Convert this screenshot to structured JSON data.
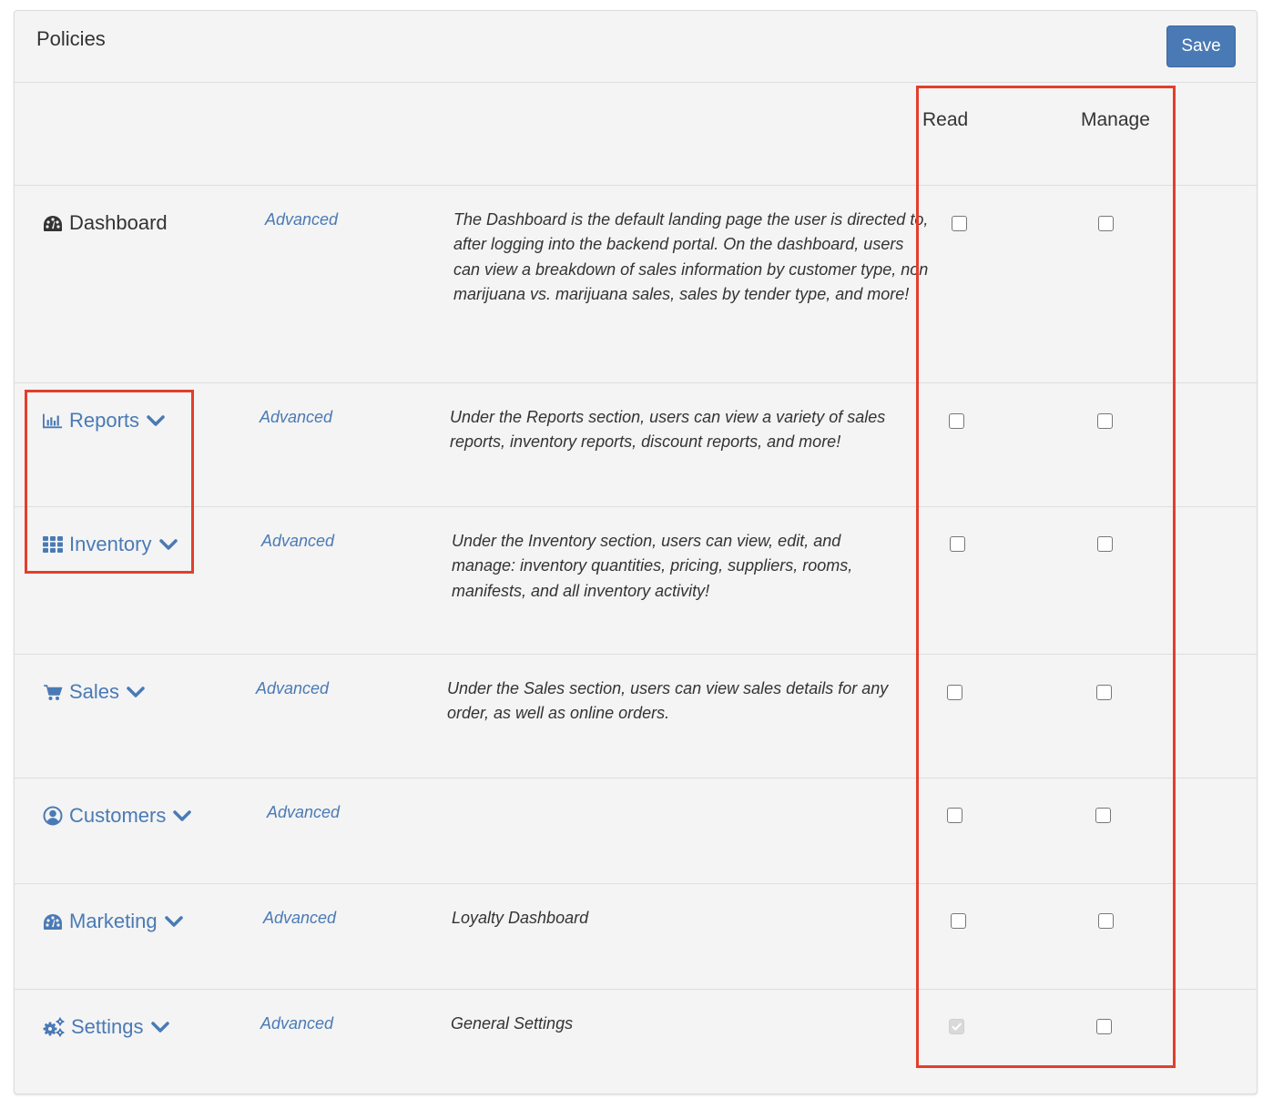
{
  "panel": {
    "title": "Policies",
    "save_label": "Save"
  },
  "columns": {
    "read": "Read",
    "manage": "Manage"
  },
  "colors": {
    "accent": "#4a7ab5",
    "highlight": "#e33e2b",
    "panel_bg": "#f4f4f4"
  },
  "rows": [
    {
      "label": "Dashboard",
      "icon": "dashboard-gauge-icon",
      "expandable": false,
      "advanced": "Advanced",
      "description": "The Dashboard is the default landing page the user is directed to, after logging into the backend portal. On the dashboard, users can view a breakdown of sales information by customer type, non marijuana vs. marijuana sales, sales by tender type, and more!",
      "read": false,
      "manage": false
    },
    {
      "label": "Reports",
      "icon": "bar-chart-icon",
      "expandable": true,
      "advanced": "Advanced",
      "description": "Under the Reports section, users can view a variety of sales reports, inventory reports, discount reports, and more!",
      "read": false,
      "manage": false
    },
    {
      "label": "Inventory",
      "icon": "grid-icon",
      "expandable": true,
      "advanced": "Advanced",
      "description": "Under the Inventory section, users can view, edit, and manage: inventory quantities, pricing, suppliers, rooms, manifests, and all inventory activity!",
      "read": false,
      "manage": false
    },
    {
      "label": "Sales",
      "icon": "shopping-cart-icon",
      "expandable": true,
      "advanced": "Advanced",
      "description": "Under the Sales section, users can view sales details for any order, as well as online orders.",
      "read": false,
      "manage": false
    },
    {
      "label": "Customers",
      "icon": "user-circle-icon",
      "expandable": true,
      "advanced": "Advanced",
      "description": "",
      "read": false,
      "manage": false
    },
    {
      "label": "Marketing",
      "icon": "dashboard-gauge-icon",
      "expandable": true,
      "advanced": "Advanced",
      "description": "Loyalty Dashboard",
      "read": false,
      "manage": false
    },
    {
      "label": "Settings",
      "icon": "gears-icon",
      "expandable": true,
      "advanced": "Advanced",
      "description": "General Settings",
      "read": true,
      "read_disabled": true,
      "manage": false
    }
  ]
}
